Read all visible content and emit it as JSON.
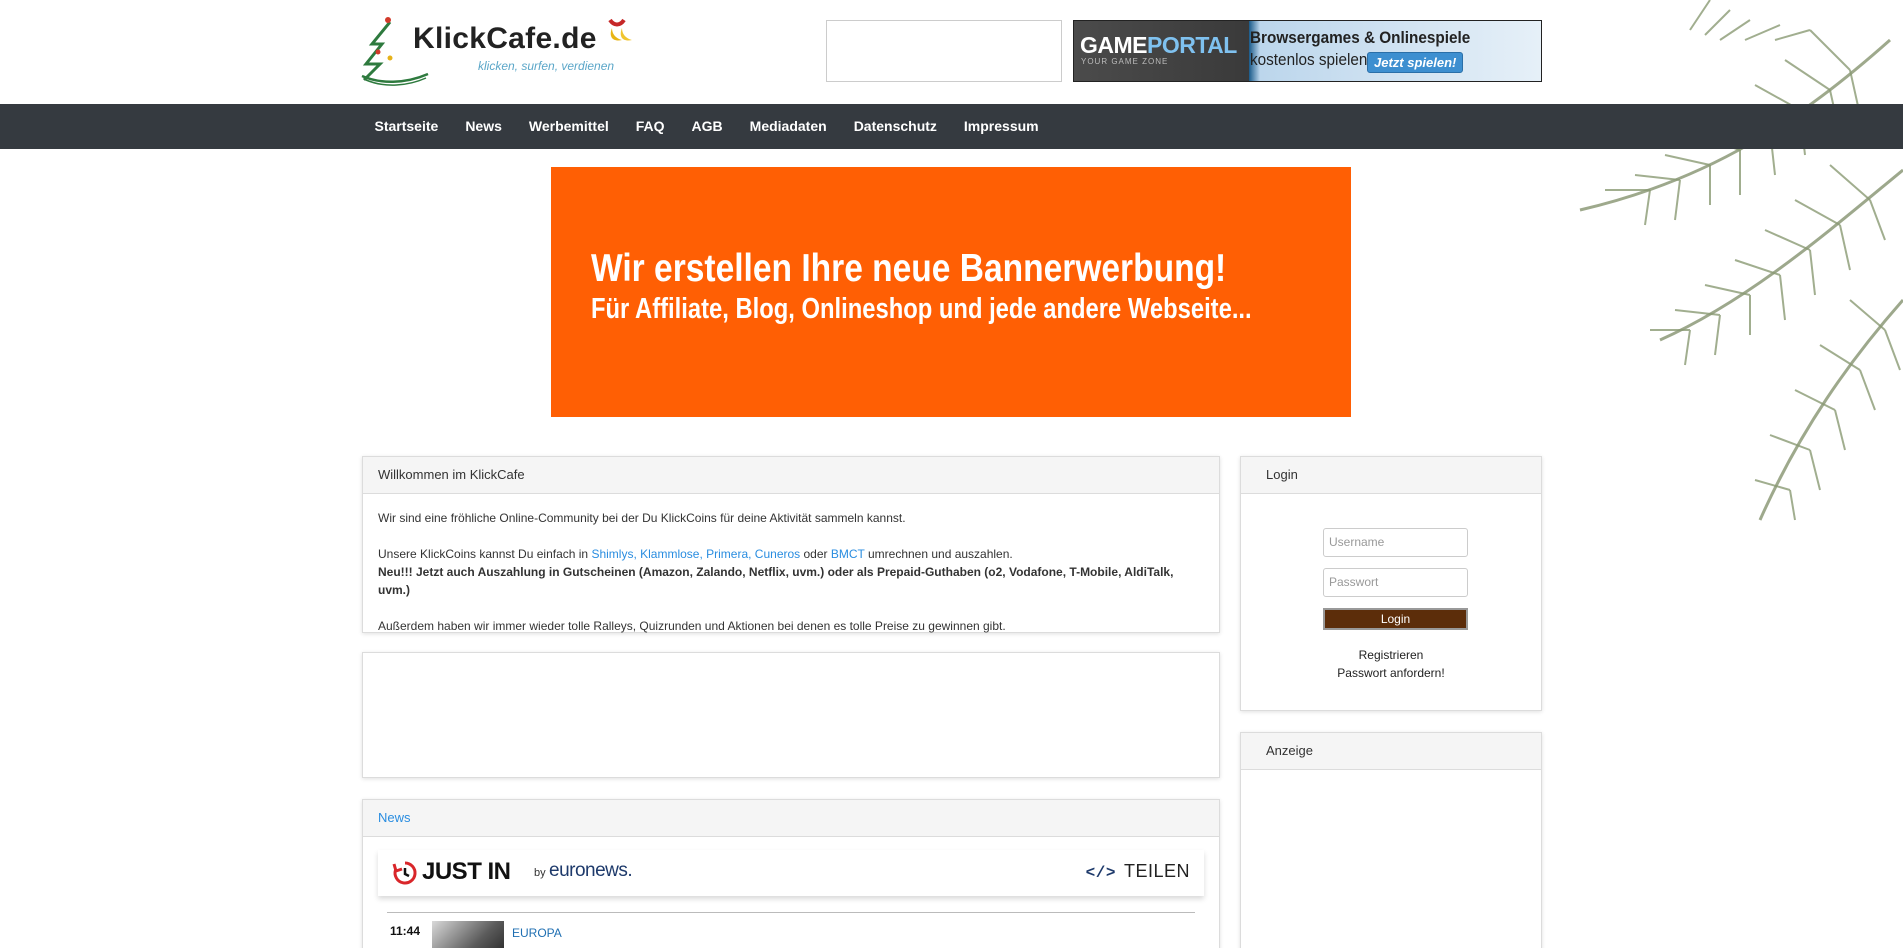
{
  "header": {
    "logo_text": "KlickCafe.de",
    "logo_slogan": "klicken, surfen, verdienen",
    "gameportal": {
      "brand_game": "GAME",
      "brand_portal": "PORTAL",
      "brand_sub": "YOUR GAME ZONE",
      "headline": "Browsergames & Onlinespiele",
      "subline": "kostenlos spielen!",
      "cta": "Jetzt spielen!"
    }
  },
  "nav": {
    "items": [
      "Startseite",
      "News",
      "Werbemittel",
      "FAQ",
      "AGB",
      "Mediadaten",
      "Datenschutz",
      "Impressum"
    ]
  },
  "hero": {
    "line1": "Wir erstellen Ihre neue Bannerwerbung!",
    "line2": "Für Affiliate, Blog, Onlineshop und jede andere Webseite...",
    "bg_color": "#ff5f04"
  },
  "welcome": {
    "title": "Willkommen im KlickCafe",
    "p1": "Wir sind eine fröhliche Online-Community bei der Du KlickCoins für deine Aktivität sammeln kannst.",
    "p2_pre": "Unsere KlickCoins kannst Du einfach in ",
    "p2_links": "Shimlys, Klammlose, Primera, Cuneros",
    "p2_mid": " oder ",
    "p2_link2": "BMCT",
    "p2_post": " umrechnen und auszahlen.",
    "p3": "Neu!!! Jetzt auch Auszahlung in Gutscheinen (Amazon, Zalando, Netflix, uvm.) oder als Prepaid-Guthaben (o2, Vodafone, T-Mobile, AldiTalk, uvm.)",
    "p4": "Außerdem haben wir immer wieder tolle Ralleys, Quizrunden und Aktionen bei denen es tolle Preise zu gewinnen gibt."
  },
  "news": {
    "title": "News",
    "widget": {
      "just_in": "JUST IN",
      "by": "by",
      "brand": "euronews.",
      "share": "TEILEN"
    },
    "items": [
      {
        "time": "11:44",
        "category": "EUROPA"
      }
    ]
  },
  "login": {
    "title": "Login",
    "username_placeholder": "Username",
    "password_placeholder": "Passwort",
    "button": "Login",
    "register": "Registrieren",
    "forgot": "Passwort anfordern!"
  },
  "anzeige": {
    "title": "Anzeige"
  },
  "colors": {
    "navbar": "#353a40",
    "link": "#2a8de0",
    "login_button": "#5c2d0a"
  }
}
